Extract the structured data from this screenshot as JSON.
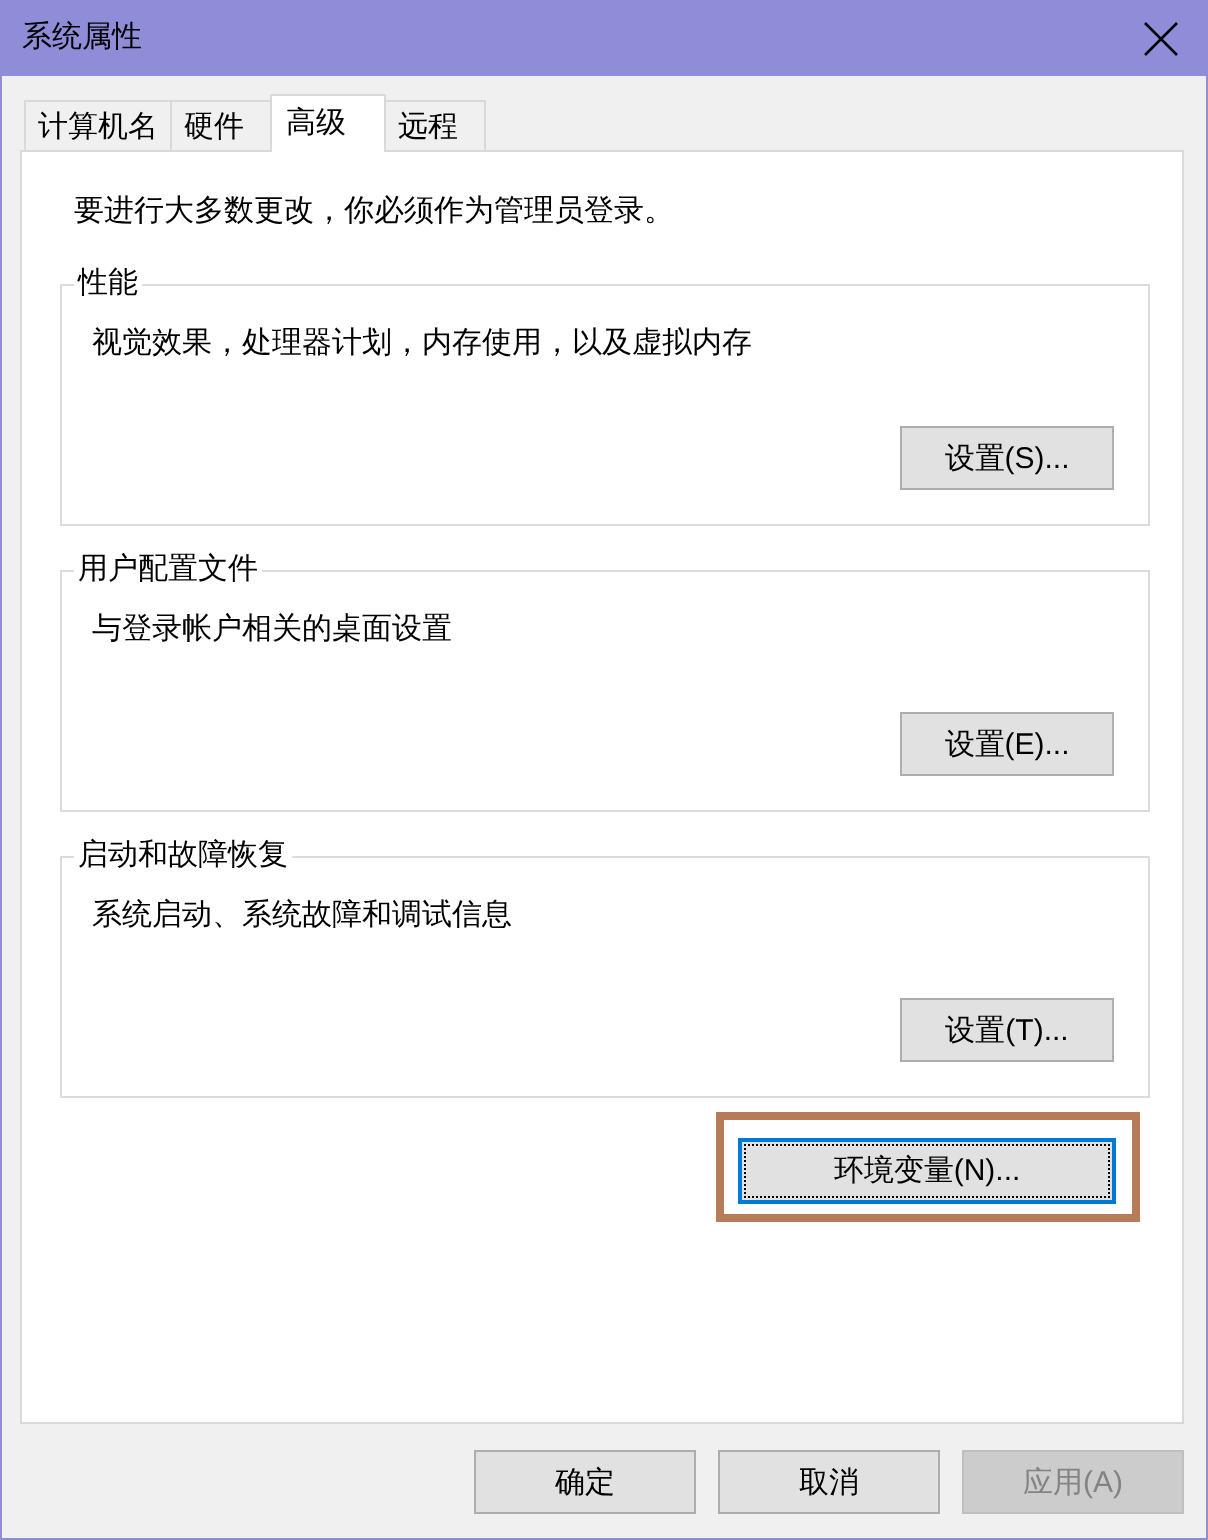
{
  "window": {
    "title": "系统属性"
  },
  "tabs": [
    {
      "label": "计算机名",
      "selected": false
    },
    {
      "label": "硬件",
      "selected": false
    },
    {
      "label": "高级",
      "selected": true
    },
    {
      "label": "远程",
      "selected": false
    }
  ],
  "panel": {
    "notice": "要进行大多数更改，你必须作为管理员登录。",
    "groups": [
      {
        "title": "性能",
        "description": "视觉效果，处理器计划，内存使用，以及虚拟内存",
        "button": {
          "label": "设置(S)..."
        }
      },
      {
        "title": "用户配置文件",
        "description": "与登录帐户相关的桌面设置",
        "button": {
          "label": "设置(E)..."
        }
      },
      {
        "title": "启动和故障恢复",
        "description": "系统启动、系统故障和调试信息",
        "button": {
          "label": "设置(T)..."
        }
      }
    ],
    "extra_button": {
      "label": "环境变量(N)...",
      "focused": true,
      "highlighted": true
    }
  },
  "buttons": [
    {
      "label": "确定",
      "disabled": false
    },
    {
      "label": "取消",
      "disabled": false
    },
    {
      "label": "应用(A)",
      "disabled": true
    }
  ]
}
